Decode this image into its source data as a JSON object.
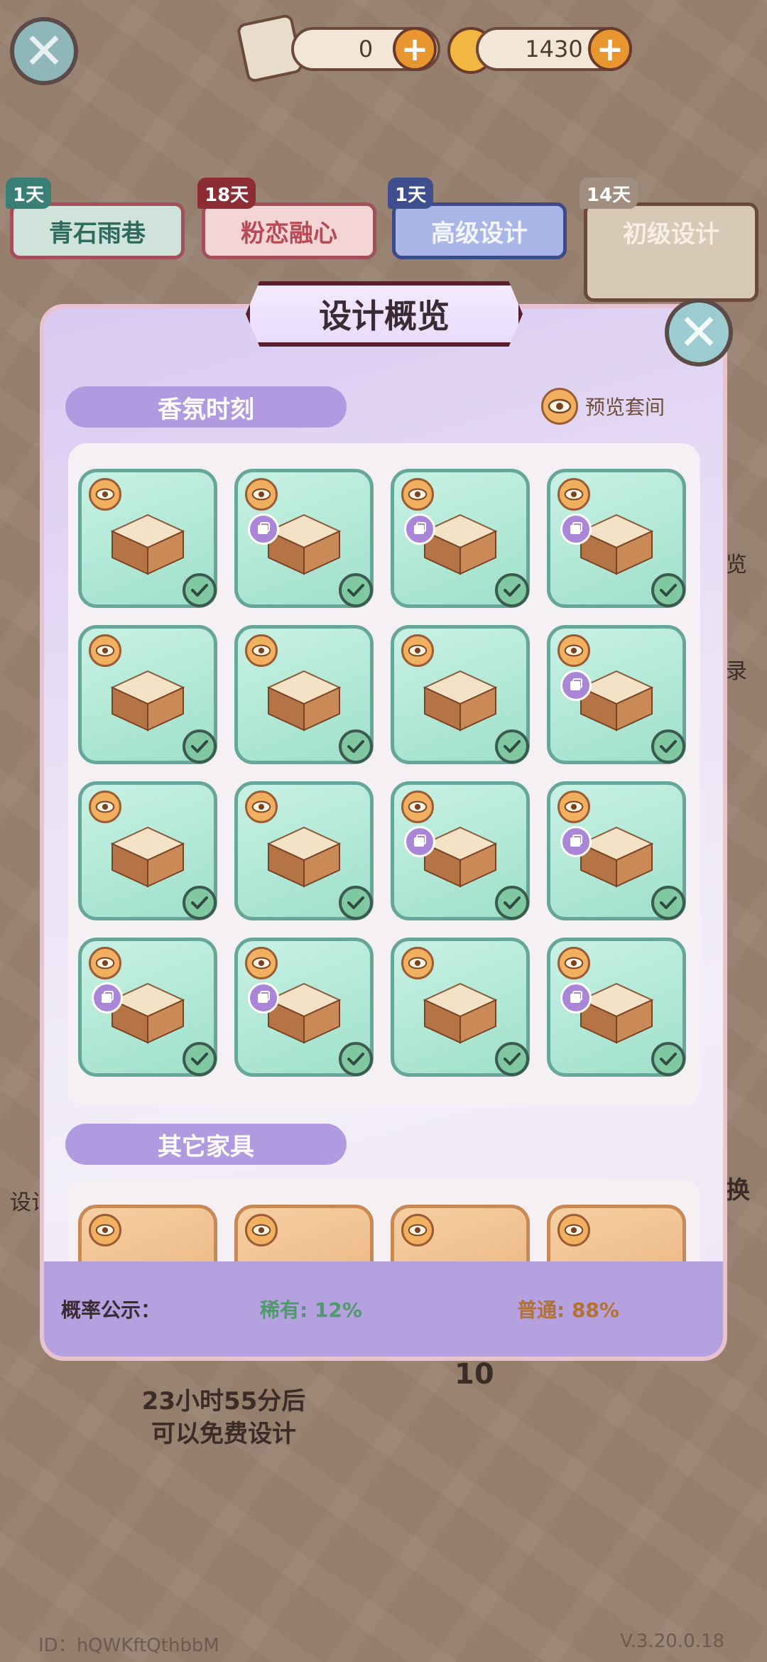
{
  "top": {
    "scroll_count": "0",
    "coin_count": "1430"
  },
  "tabs": [
    {
      "label": "青石雨巷",
      "badge": "1天"
    },
    {
      "label": "粉恋融心",
      "badge": "18天"
    },
    {
      "label": "高级设计",
      "badge": "1天"
    },
    {
      "label": "初级设计",
      "badge": "14天"
    }
  ],
  "background": {
    "free_line1": "23小时55分后",
    "free_line2": "可以免费设计",
    "player_id": "ID：hQWKftQthbbM",
    "version": "V.3.20.0.18",
    "side_text_1": "览",
    "side_text_2": "录",
    "side_text_3": "换",
    "left_text": "设计",
    "ten_label": "10"
  },
  "modal": {
    "title": "设计概览",
    "section1": "香氛时刻",
    "preview_label": "预览套间",
    "section2": "其它家具",
    "prob_label": "概率公示：",
    "rare": "稀有: 12%",
    "common": "普通: 88%"
  },
  "items": [
    {
      "name": "floor-tile",
      "tag": false
    },
    {
      "name": "cabinet",
      "tag": true
    },
    {
      "name": "sink-vanity",
      "tag": true
    },
    {
      "name": "bathtub",
      "tag": true
    },
    {
      "name": "counter",
      "tag": false
    },
    {
      "name": "shelf",
      "tag": false
    },
    {
      "name": "partition",
      "tag": false
    },
    {
      "name": "toilet",
      "tag": true
    },
    {
      "name": "tall-shelf",
      "tag": false
    },
    {
      "name": "wall-hook",
      "tag": false
    },
    {
      "name": "washer",
      "tag": true
    },
    {
      "name": "mirror",
      "tag": true
    },
    {
      "name": "glass-cabinet",
      "tag": true
    },
    {
      "name": "blinds",
      "tag": true
    },
    {
      "name": "storage-rack",
      "tag": false
    },
    {
      "name": "shower",
      "tag": true
    }
  ],
  "colors": {
    "rare": "#4e9a6a",
    "common": "#b5722f"
  }
}
